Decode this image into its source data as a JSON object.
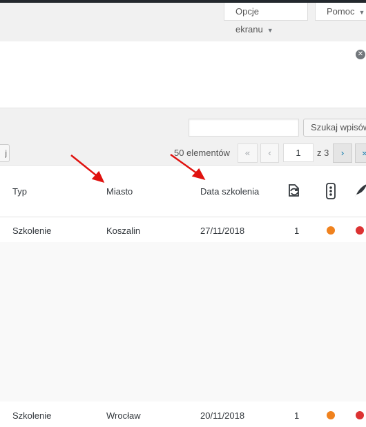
{
  "header": {
    "screen_options_label": "Opcje ekranu",
    "help_label": "Pomoc"
  },
  "notice": {
    "dismiss_glyph": "✕"
  },
  "search": {
    "input_value": "",
    "button_label": "Szukaj wpisów"
  },
  "pagination": {
    "items_count": "50 elementów",
    "first": "«",
    "prev": "‹",
    "current_page": "1",
    "of_total": "z 3",
    "next": "›",
    "last": "»"
  },
  "bulk": {
    "apply_label": "j"
  },
  "table": {
    "columns": [
      "Typ",
      "Miasto",
      "Data szkolenia"
    ],
    "icon_columns": [
      "refresh-icon",
      "traffic-light-icon",
      "feather-icon"
    ],
    "rows": [
      {
        "typ": "Szkolenie",
        "miasto": "Koszalin",
        "data": "27/11/2018",
        "num": "1"
      },
      {
        "typ": "Szkolenie",
        "miasto": "Wrocław",
        "data": "20/11/2018",
        "num": "1"
      }
    ]
  },
  "colors": {
    "dot_orange": "#f0821e",
    "dot_red": "#dc3232",
    "annotation_red": "#e0120f",
    "link_blue": "#0073aa"
  }
}
